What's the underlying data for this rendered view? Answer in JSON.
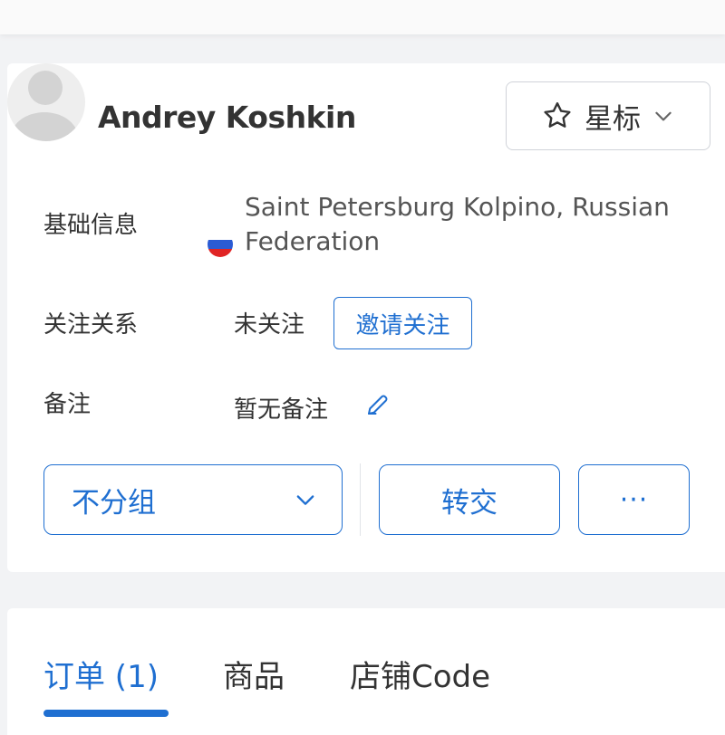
{
  "contact": {
    "name": "Andrey Koshkin",
    "star_label": "星标"
  },
  "info": {
    "basic_label": "基础信息",
    "location": "Saint Petersburg Kolpino, Russian Federation",
    "follow_label": "关注关系",
    "follow_status": "未关注",
    "invite_label": "邀请关注",
    "remark_label": "备注",
    "remark_value": "暂无备注"
  },
  "actions": {
    "group_value": "不分组",
    "transfer_label": "转交",
    "more_label": "···"
  },
  "tabs": [
    {
      "label": "订单 (1)",
      "active": true
    },
    {
      "label": "商品",
      "active": false
    },
    {
      "label": "店铺Code",
      "active": false
    }
  ],
  "colors": {
    "accent": "#1f6fd1",
    "text": "#333333",
    "border": "#d0d3d9"
  },
  "icons": {
    "star": "star-outline-icon",
    "chevron": "chevron-down-icon",
    "edit": "pencil-icon",
    "flag": "russia-flag-icon"
  }
}
